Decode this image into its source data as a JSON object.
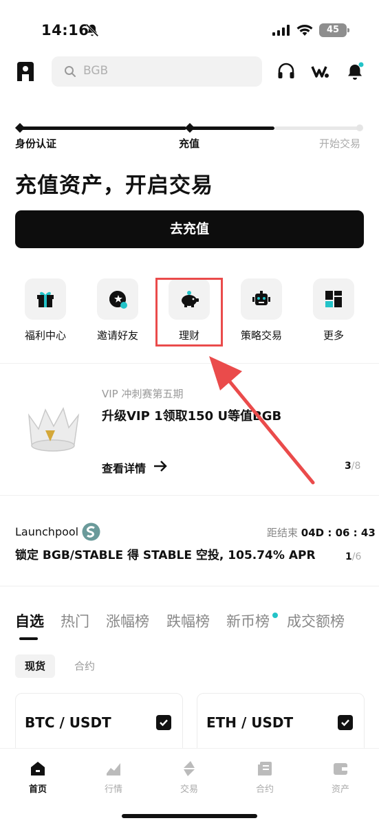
{
  "status_bar": {
    "time": "14:16",
    "battery": "45"
  },
  "header": {
    "search_placeholder": "BGB"
  },
  "progress": {
    "steps": [
      "身份认证",
      "充值",
      "开始交易"
    ],
    "current_step": 2
  },
  "headline": "充值资产，开启交易",
  "cta_label": "去充值",
  "quick_actions": [
    {
      "label": "福利中心",
      "icon": "gift-icon"
    },
    {
      "label": "邀请好友",
      "icon": "invite-icon"
    },
    {
      "label": "理财",
      "icon": "piggy-bank-icon"
    },
    {
      "label": "策略交易",
      "icon": "robot-icon"
    },
    {
      "label": "更多",
      "icon": "grid-icon"
    }
  ],
  "banner": {
    "subtitle": "VIP 冲刺赛第五期",
    "title": "升级VIP 1领取150 U等值BGB",
    "link": "查看详情",
    "pager_current": "3",
    "pager_total": "/8"
  },
  "launchpool": {
    "name": "Launchpool",
    "countdown_label": "距结束",
    "countdown": "04D : 06 : 43",
    "description": "锁定 BGB/STABLE 得 STABLE 空投, 105.74% APR",
    "pager_current": "1",
    "pager_total": "/6"
  },
  "market_tabs": [
    "自选",
    "热门",
    "涨幅榜",
    "跌幅榜",
    "新币榜",
    "成交额榜"
  ],
  "sub_tabs": [
    "现货",
    "合约"
  ],
  "watchlist": [
    "BTC / USDT",
    "ETH / USDT"
  ],
  "bottom_nav": [
    "首页",
    "行情",
    "交易",
    "合约",
    "资产"
  ],
  "colors": {
    "accent": "#23c3c8",
    "annotation": "#ea4b4b",
    "primary": "#0d0d0d"
  }
}
